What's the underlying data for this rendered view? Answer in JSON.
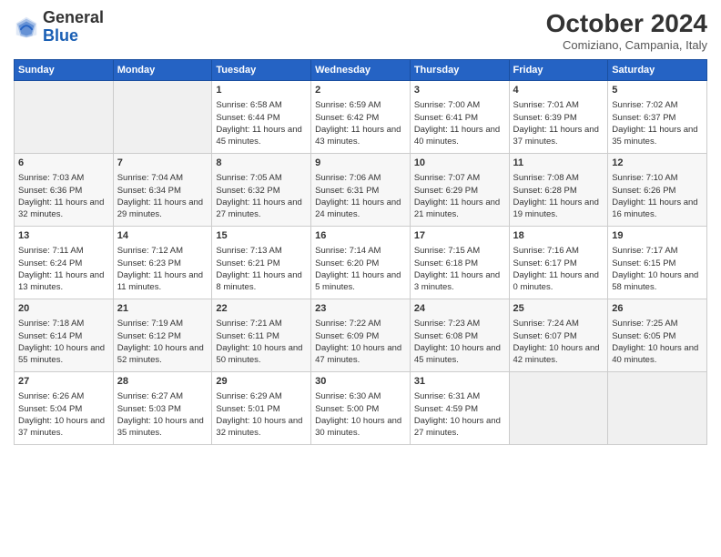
{
  "logo": {
    "general": "General",
    "blue": "Blue"
  },
  "header": {
    "title": "October 2024",
    "subtitle": "Comiziano, Campania, Italy"
  },
  "weekdays": [
    "Sunday",
    "Monday",
    "Tuesday",
    "Wednesday",
    "Thursday",
    "Friday",
    "Saturday"
  ],
  "weeks": [
    [
      {
        "day": "",
        "info": ""
      },
      {
        "day": "",
        "info": ""
      },
      {
        "day": "1",
        "info": "Sunrise: 6:58 AM\nSunset: 6:44 PM\nDaylight: 11 hours and 45 minutes."
      },
      {
        "day": "2",
        "info": "Sunrise: 6:59 AM\nSunset: 6:42 PM\nDaylight: 11 hours and 43 minutes."
      },
      {
        "day": "3",
        "info": "Sunrise: 7:00 AM\nSunset: 6:41 PM\nDaylight: 11 hours and 40 minutes."
      },
      {
        "day": "4",
        "info": "Sunrise: 7:01 AM\nSunset: 6:39 PM\nDaylight: 11 hours and 37 minutes."
      },
      {
        "day": "5",
        "info": "Sunrise: 7:02 AM\nSunset: 6:37 PM\nDaylight: 11 hours and 35 minutes."
      }
    ],
    [
      {
        "day": "6",
        "info": "Sunrise: 7:03 AM\nSunset: 6:36 PM\nDaylight: 11 hours and 32 minutes."
      },
      {
        "day": "7",
        "info": "Sunrise: 7:04 AM\nSunset: 6:34 PM\nDaylight: 11 hours and 29 minutes."
      },
      {
        "day": "8",
        "info": "Sunrise: 7:05 AM\nSunset: 6:32 PM\nDaylight: 11 hours and 27 minutes."
      },
      {
        "day": "9",
        "info": "Sunrise: 7:06 AM\nSunset: 6:31 PM\nDaylight: 11 hours and 24 minutes."
      },
      {
        "day": "10",
        "info": "Sunrise: 7:07 AM\nSunset: 6:29 PM\nDaylight: 11 hours and 21 minutes."
      },
      {
        "day": "11",
        "info": "Sunrise: 7:08 AM\nSunset: 6:28 PM\nDaylight: 11 hours and 19 minutes."
      },
      {
        "day": "12",
        "info": "Sunrise: 7:10 AM\nSunset: 6:26 PM\nDaylight: 11 hours and 16 minutes."
      }
    ],
    [
      {
        "day": "13",
        "info": "Sunrise: 7:11 AM\nSunset: 6:24 PM\nDaylight: 11 hours and 13 minutes."
      },
      {
        "day": "14",
        "info": "Sunrise: 7:12 AM\nSunset: 6:23 PM\nDaylight: 11 hours and 11 minutes."
      },
      {
        "day": "15",
        "info": "Sunrise: 7:13 AM\nSunset: 6:21 PM\nDaylight: 11 hours and 8 minutes."
      },
      {
        "day": "16",
        "info": "Sunrise: 7:14 AM\nSunset: 6:20 PM\nDaylight: 11 hours and 5 minutes."
      },
      {
        "day": "17",
        "info": "Sunrise: 7:15 AM\nSunset: 6:18 PM\nDaylight: 11 hours and 3 minutes."
      },
      {
        "day": "18",
        "info": "Sunrise: 7:16 AM\nSunset: 6:17 PM\nDaylight: 11 hours and 0 minutes."
      },
      {
        "day": "19",
        "info": "Sunrise: 7:17 AM\nSunset: 6:15 PM\nDaylight: 10 hours and 58 minutes."
      }
    ],
    [
      {
        "day": "20",
        "info": "Sunrise: 7:18 AM\nSunset: 6:14 PM\nDaylight: 10 hours and 55 minutes."
      },
      {
        "day": "21",
        "info": "Sunrise: 7:19 AM\nSunset: 6:12 PM\nDaylight: 10 hours and 52 minutes."
      },
      {
        "day": "22",
        "info": "Sunrise: 7:21 AM\nSunset: 6:11 PM\nDaylight: 10 hours and 50 minutes."
      },
      {
        "day": "23",
        "info": "Sunrise: 7:22 AM\nSunset: 6:09 PM\nDaylight: 10 hours and 47 minutes."
      },
      {
        "day": "24",
        "info": "Sunrise: 7:23 AM\nSunset: 6:08 PM\nDaylight: 10 hours and 45 minutes."
      },
      {
        "day": "25",
        "info": "Sunrise: 7:24 AM\nSunset: 6:07 PM\nDaylight: 10 hours and 42 minutes."
      },
      {
        "day": "26",
        "info": "Sunrise: 7:25 AM\nSunset: 6:05 PM\nDaylight: 10 hours and 40 minutes."
      }
    ],
    [
      {
        "day": "27",
        "info": "Sunrise: 6:26 AM\nSunset: 5:04 PM\nDaylight: 10 hours and 37 minutes."
      },
      {
        "day": "28",
        "info": "Sunrise: 6:27 AM\nSunset: 5:03 PM\nDaylight: 10 hours and 35 minutes."
      },
      {
        "day": "29",
        "info": "Sunrise: 6:29 AM\nSunset: 5:01 PM\nDaylight: 10 hours and 32 minutes."
      },
      {
        "day": "30",
        "info": "Sunrise: 6:30 AM\nSunset: 5:00 PM\nDaylight: 10 hours and 30 minutes."
      },
      {
        "day": "31",
        "info": "Sunrise: 6:31 AM\nSunset: 4:59 PM\nDaylight: 10 hours and 27 minutes."
      },
      {
        "day": "",
        "info": ""
      },
      {
        "day": "",
        "info": ""
      }
    ]
  ]
}
